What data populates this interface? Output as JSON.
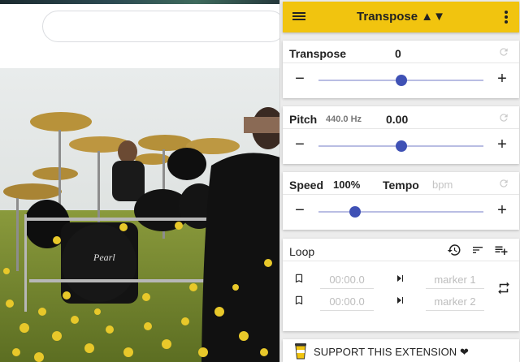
{
  "header": {
    "title": "Transpose ▲▼"
  },
  "transpose": {
    "label": "Transpose",
    "value": "0",
    "minus": "−",
    "plus": "+",
    "slider_position": 0.5
  },
  "pitch": {
    "label": "Pitch",
    "reference": "440.0 Hz",
    "value": "0.00",
    "minus": "−",
    "plus": "+",
    "slider_position": 0.5
  },
  "speed": {
    "label": "Speed",
    "value": "100%",
    "tempo_label": "Tempo",
    "tempo_placeholder": "bpm",
    "minus": "−",
    "plus": "+",
    "slider_position": 0.22
  },
  "loop": {
    "label": "Loop",
    "rows": [
      {
        "time_placeholder": "00:00.0",
        "marker_placeholder": "marker 1"
      },
      {
        "time_placeholder": "00:00.0",
        "marker_placeholder": "marker 2"
      }
    ]
  },
  "support": {
    "label": "SUPPORT THIS EXTENSION ❤"
  },
  "colors": {
    "header": "#f1c40f",
    "accent": "#3f51b5",
    "track": "#b9bde3"
  }
}
